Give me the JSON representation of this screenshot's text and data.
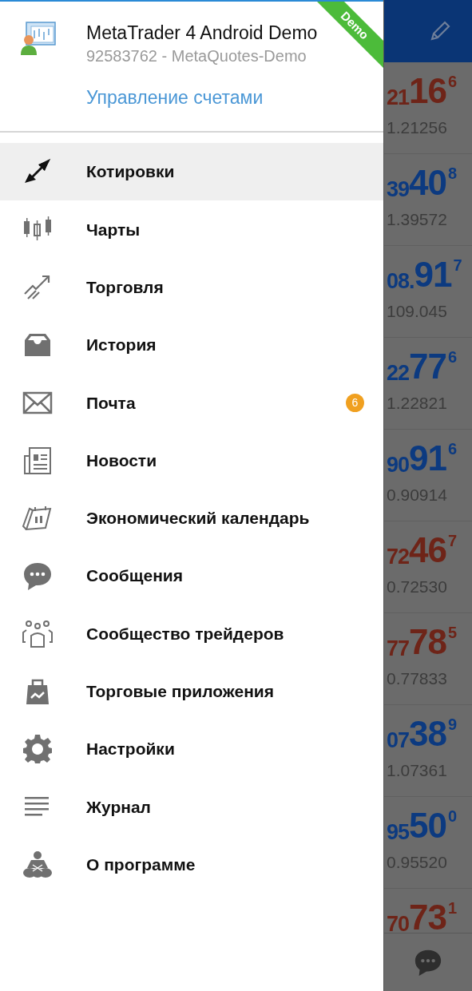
{
  "account": {
    "name": "MetaTrader 4 Android Demo",
    "details": "92583762 - MetaQuotes-Demo",
    "manage_link": "Управление счетами",
    "ribbon": "Demo"
  },
  "menu": [
    {
      "label": "Котировки",
      "selected": true
    },
    {
      "label": "Чарты",
      "selected": false
    },
    {
      "label": "Торговля",
      "selected": false
    },
    {
      "label": "История",
      "selected": false
    },
    {
      "label": "Почта",
      "selected": false,
      "badge": "6"
    },
    {
      "label": "Новости",
      "selected": false
    },
    {
      "label": "Экономический календарь",
      "selected": false
    },
    {
      "label": "Сообщения",
      "selected": false
    },
    {
      "label": "Сообщество трейдеров",
      "selected": false
    },
    {
      "label": "Торговые приложения",
      "selected": false
    },
    {
      "label": "Настройки",
      "selected": false
    },
    {
      "label": "Журнал",
      "selected": false
    },
    {
      "label": "О программе",
      "selected": false
    }
  ],
  "quotes": [
    {
      "prefix": "21",
      "big": "16",
      "sup": "6",
      "low": "1.21256",
      "color": "#6e2418"
    },
    {
      "prefix": "39",
      "big": "40",
      "sup": "8",
      "low": "1.39572",
      "color": "#0c3a80"
    },
    {
      "prefix": "08.",
      "big": "91",
      "sup": "7",
      "low": "109.045",
      "color": "#0c3a80"
    },
    {
      "prefix": "22",
      "big": "77",
      "sup": "6",
      "low": "1.22821",
      "color": "#0c3a80"
    },
    {
      "prefix": "90",
      "big": "91",
      "sup": "6",
      "low": "0.90914",
      "color": "#0c3a80"
    },
    {
      "prefix": "72",
      "big": "46",
      "sup": "7",
      "low": "0.72530",
      "color": "#6e2418"
    },
    {
      "prefix": "77",
      "big": "78",
      "sup": "5",
      "low": "0.77833",
      "color": "#6e2418"
    },
    {
      "prefix": "07",
      "big": "38",
      "sup": "9",
      "low": "1.07361",
      "color": "#0c3a80"
    },
    {
      "prefix": "95",
      "big": "50",
      "sup": "0",
      "low": "0.95520",
      "color": "#0c3a80"
    },
    {
      "prefix": "70",
      "big": "73",
      "sup": "1",
      "color": "#6e2418"
    }
  ]
}
